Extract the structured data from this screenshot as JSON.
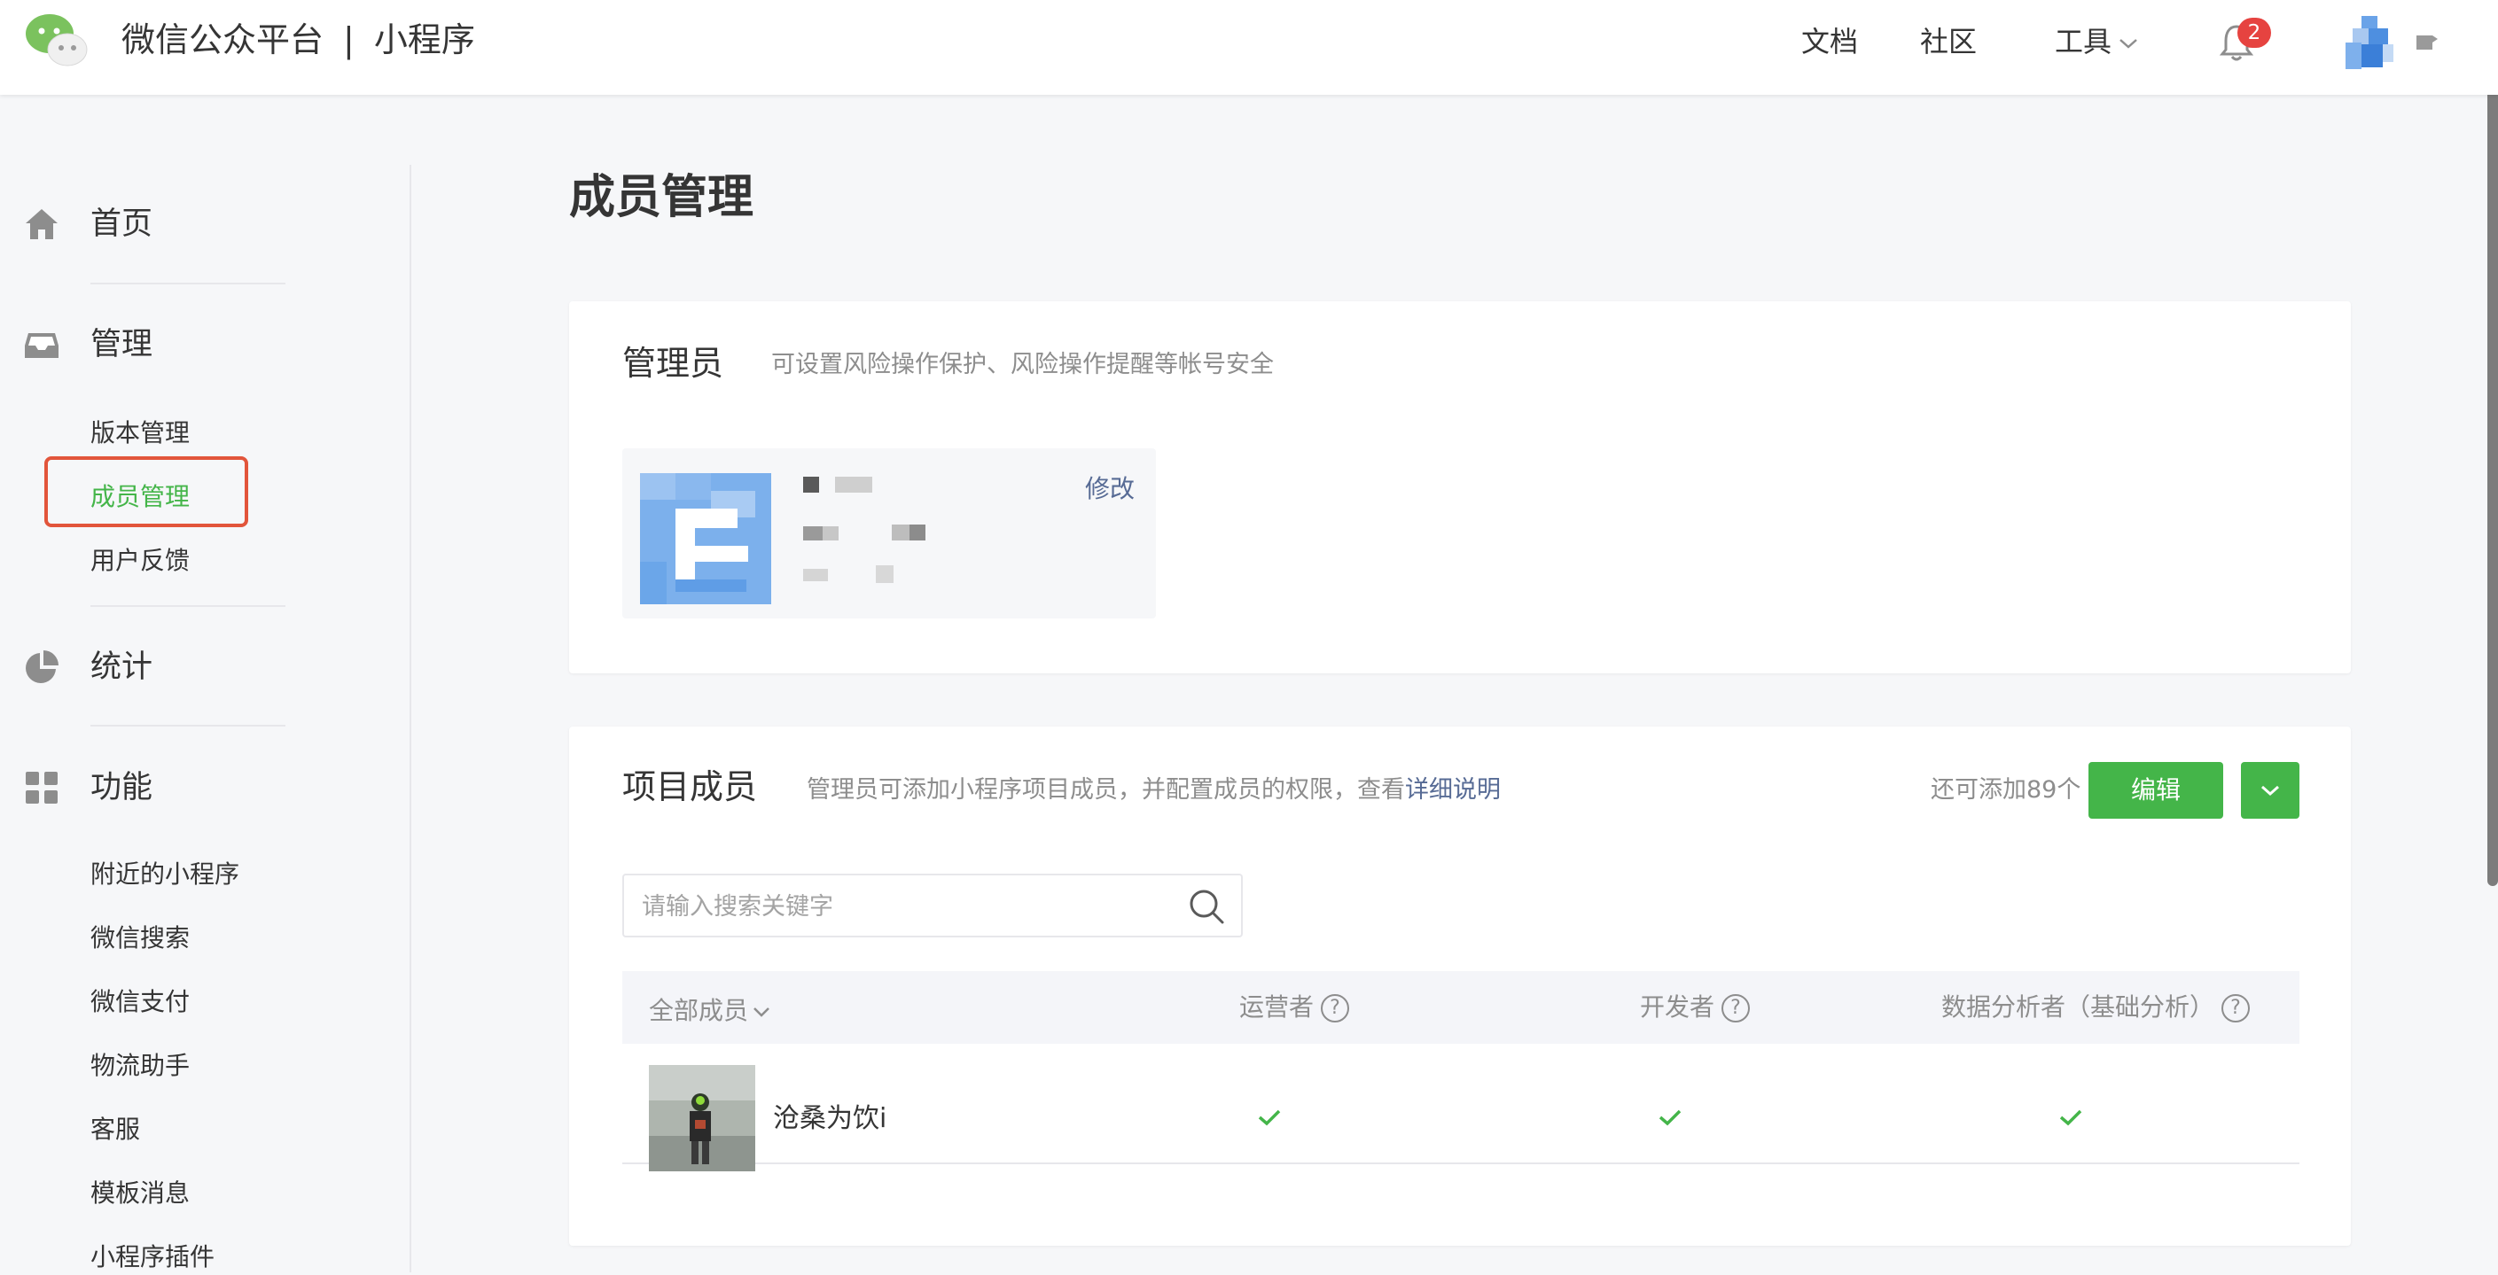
{
  "header": {
    "brand_title": "微信公众平台",
    "brand_separator": "|",
    "brand_subtitle": "小程序",
    "nav": {
      "docs": "文档",
      "community": "社区",
      "tools": "工具"
    },
    "notification_count": "2"
  },
  "sidebar": {
    "groups": [
      {
        "label": "首页",
        "icon": "home-icon"
      },
      {
        "label": "管理",
        "icon": "inbox-icon",
        "items": [
          "版本管理",
          "成员管理",
          "用户反馈"
        ]
      },
      {
        "label": "统计",
        "icon": "pie-chart-icon"
      },
      {
        "label": "功能",
        "icon": "grid-icon",
        "items": [
          "附近的小程序",
          "微信搜索",
          "微信支付",
          "物流助手",
          "客服",
          "模板消息",
          "小程序插件"
        ]
      }
    ],
    "active_item": "成员管理"
  },
  "page": {
    "title": "成员管理"
  },
  "admin": {
    "title": "管理员",
    "description": "可设置风险操作保护、风险操作提醒等帐号安全",
    "edit_label": "修改"
  },
  "members": {
    "title": "项目成员",
    "description": "管理员可添加小程序项目成员，并配置成员的权限，查看",
    "detail_link": "详细说明",
    "remaining": "还可添加89个",
    "edit_button": "编辑",
    "search_placeholder": "请输入搜索关键字",
    "columns": {
      "all_members": "全部成员",
      "operator": "运营者",
      "developer": "开发者",
      "analyst": "数据分析者（基础分析）"
    },
    "rows": [
      {
        "name": "沧桑为饮i",
        "operator": true,
        "developer": true,
        "analyst": true
      }
    ]
  },
  "colors": {
    "brand_green": "#44b549",
    "link_blue": "#576b95",
    "badge_red": "#e64340",
    "highlight_box": "#e2553b"
  }
}
